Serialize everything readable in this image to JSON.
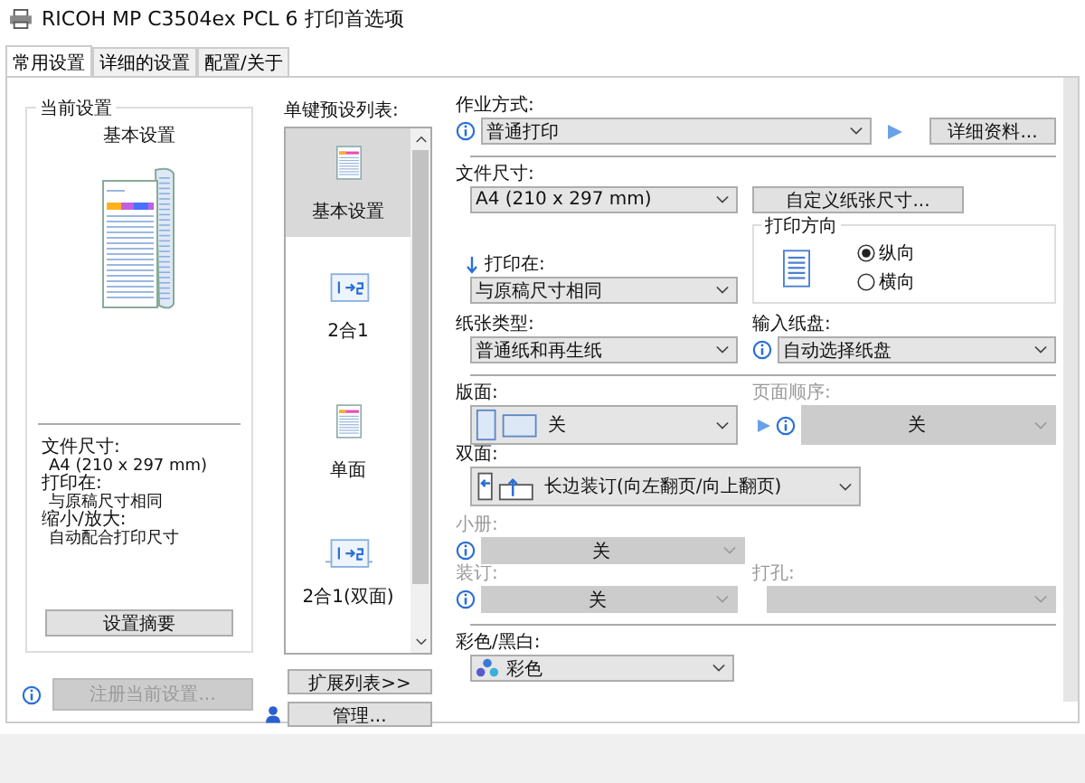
{
  "window": {
    "title": "RICOH MP C3504ex PCL 6 打印首选项"
  },
  "tabs": [
    {
      "label": "常用设置",
      "selected": true
    },
    {
      "label": "详细的设置",
      "selected": false
    },
    {
      "label": "配置/关于",
      "selected": false
    }
  ],
  "current_settings": {
    "title": "当前设置",
    "preset_name": "基本设置",
    "summary": [
      {
        "label": "文件尺寸:",
        "value": "A4 (210 x 297 mm)"
      },
      {
        "label": "打印在:",
        "value": "与原稿尺寸相同"
      },
      {
        "label": "缩小/放大:",
        "value": "自动配合打印尺寸"
      }
    ],
    "summary_button": "设置摘要",
    "register_button": {
      "label": "注册当前设置...",
      "disabled": true
    }
  },
  "preset_list": {
    "title": "单键预设列表:",
    "items": [
      {
        "label": "基本设置",
        "kind": "document",
        "selected": true
      },
      {
        "label": "2合1",
        "kind": "two-in-one",
        "selected": false
      },
      {
        "label": "单面",
        "kind": "document",
        "selected": false
      },
      {
        "label": "2合1(双面)",
        "kind": "two-in-one-duplex",
        "selected": false
      }
    ],
    "expand_button": "扩展列表>>",
    "manage_button": "管理..."
  },
  "job_type": {
    "label": "作业方式:",
    "value": "普通打印",
    "details_button": "详细资料..."
  },
  "paper_size": {
    "label": "文件尺寸:",
    "value": "A4 (210 x 297 mm)",
    "custom_button": "自定义纸张尺寸..."
  },
  "print_on": {
    "label": "打印在:",
    "value": "与原稿尺寸相同"
  },
  "orientation": {
    "title": "打印方向",
    "options": [
      {
        "label": "纵向",
        "selected": true
      },
      {
        "label": "横向",
        "selected": false
      }
    ]
  },
  "paper_type": {
    "label": "纸张类型:",
    "value": "普通纸和再生纸"
  },
  "input_tray": {
    "label": "输入纸盘:",
    "value": "自动选择纸盘"
  },
  "layout": {
    "label": "版面:",
    "value": "关",
    "disabled": false
  },
  "page_order": {
    "label": "页面顺序:",
    "value": "关",
    "disabled": true
  },
  "duplex": {
    "label": "双面:",
    "value": "长边装订(向左翻页/向上翻页)",
    "disabled": false
  },
  "booklet": {
    "label": "小册:",
    "value": "关",
    "disabled": true
  },
  "staple": {
    "label": "装订:",
    "value": "关",
    "disabled": true
  },
  "punch": {
    "label": "打孔:",
    "disabled": true
  },
  "color_mode": {
    "label": "彩色/黑白:",
    "value": "彩色",
    "disabled": false
  }
}
